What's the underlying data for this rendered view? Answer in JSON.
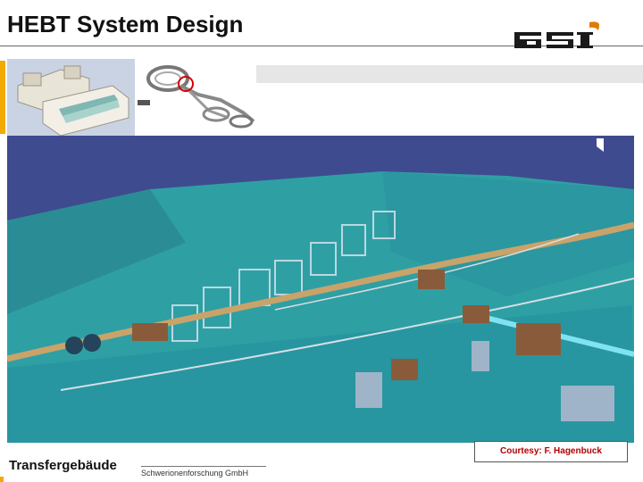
{
  "slide": {
    "title": "HEBT System Design",
    "courtesy": "Courtesy: F. Hagenbuck",
    "caption": "Transfergebäude",
    "footer": "Schwerionenforschung GmbH"
  },
  "logo": {
    "icon": "gsi-logo-icon",
    "text": "GSI",
    "colors": {
      "letters": "#1a1a1a",
      "accent": "#e07a00"
    }
  },
  "images": {
    "thumbnail_building": "building-model-icon",
    "thumbnail_accelerator": "accelerator-overview-icon",
    "main": "hebt-3d-rendering-icon"
  },
  "colors": {
    "accent": "#f2a900",
    "rendering_background": "#3f4b8f",
    "rendering_wall": "#2aa3a8",
    "courtesy_text": "#b00000"
  }
}
